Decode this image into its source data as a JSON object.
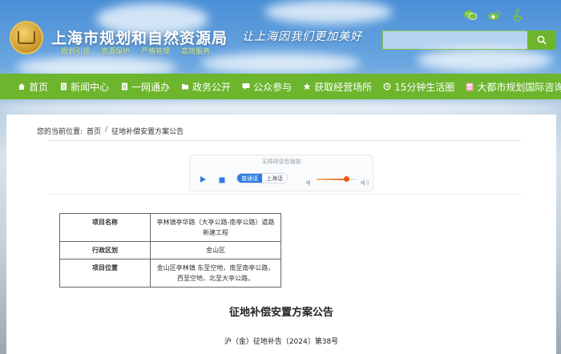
{
  "header": {
    "site_title": "上海市规划和自然资源局",
    "tags": [
      "规划引领",
      "资源保护",
      "严格管理",
      "高效服务"
    ],
    "slogan": "让上海因我们更加美好",
    "search_placeholder": "",
    "top_icons": [
      "wechat-icon",
      "weibo-icon",
      "accessibility-icon"
    ],
    "brand_color": "#6cb52d"
  },
  "nav": {
    "items": [
      {
        "label": "首页",
        "icon": "home-icon"
      },
      {
        "label": "新闻中心",
        "icon": "document-icon"
      },
      {
        "label": "一网通办",
        "icon": "document-icon"
      },
      {
        "label": "政务公开",
        "icon": "folder-icon"
      },
      {
        "label": "公众参与",
        "icon": "chat-icon"
      },
      {
        "label": "获取经营场所",
        "icon": "star-icon"
      },
      {
        "label": "15分钟生活圈",
        "icon": "circle-arrow-icon"
      },
      {
        "label": "大都市规划国际咨询会",
        "icon": "flag-icon"
      }
    ]
  },
  "breadcrumb": {
    "prefix": "您的当前位置:",
    "home": "首页",
    "separator": "/",
    "current": "征地补偿安置方案公告"
  },
  "player": {
    "title": "无障碍语音播报",
    "voice_options": [
      "普通话",
      "上海话"
    ],
    "selected_voice": "普通话",
    "volume_level": 0.75
  },
  "info_table": {
    "rows": [
      {
        "key": "项目名称",
        "value": "亭林镇亭华路（大亭公路-南亭公路）道路新建工程"
      },
      {
        "key": "行政区划",
        "value": "金山区"
      },
      {
        "key": "项目位置",
        "value": "金山区亭林镇 东至空地，南至南亭公路，西至空地，北至大亭公路。"
      }
    ]
  },
  "document": {
    "title": "征地补偿安置方案公告",
    "number": "沪（金）征地补告〔2024〕第38号"
  }
}
